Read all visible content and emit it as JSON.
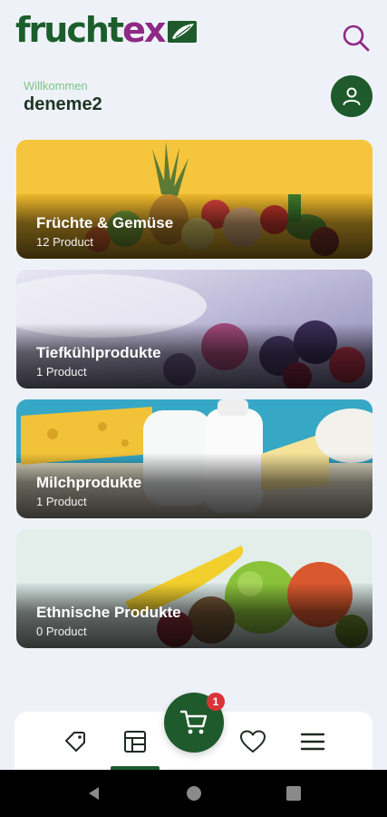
{
  "app": {
    "logo_text_green": "frucht",
    "logo_text_purple": "ex",
    "brand_green": "#1e5a2c",
    "brand_purple": "#8e2a86"
  },
  "header": {
    "welcome_label": "Willkommen",
    "username": "deneme2",
    "search_icon": "search-icon",
    "profile_icon": "user-icon"
  },
  "categories": [
    {
      "title": "Früchte & Gemüse",
      "count": "12 Product"
    },
    {
      "title": "Tiefkühlprodukte",
      "count": "1 Product"
    },
    {
      "title": "Milchprodukte",
      "count": "1 Product"
    },
    {
      "title": "Ethnische Produkte",
      "count": "0 Product"
    }
  ],
  "bottom_nav": {
    "items": [
      "tag-icon",
      "catalog-icon",
      "cart-icon",
      "heart-icon",
      "menu-icon"
    ],
    "active": "catalog-icon",
    "cart_badge": "1"
  },
  "system_bar": {
    "items": [
      "back-icon",
      "home-icon",
      "recents-icon"
    ]
  }
}
